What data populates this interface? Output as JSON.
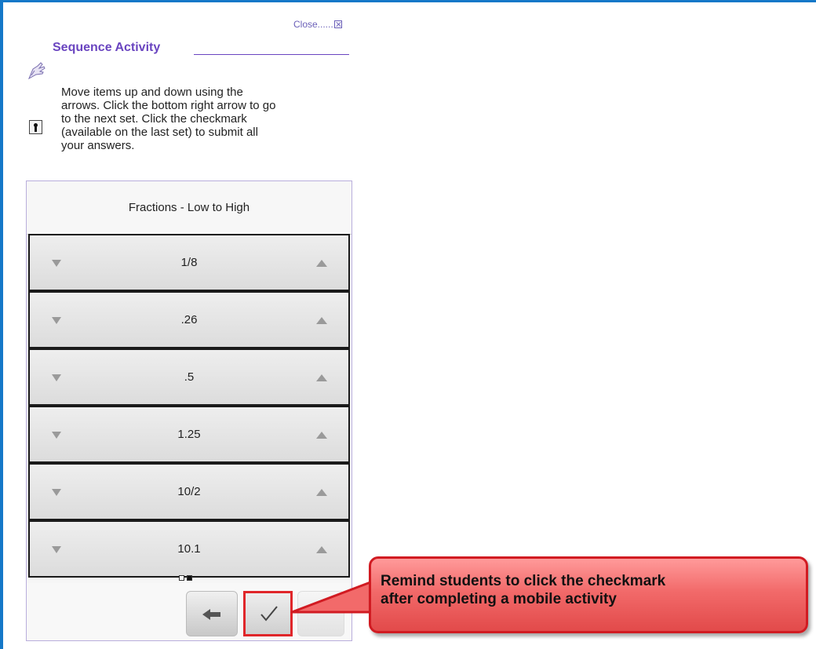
{
  "window": {
    "close_label": "Close......"
  },
  "activity": {
    "title": "Sequence Activity",
    "instructions": "Move items up and down using the\narrows. Click the bottom right arrow to go\nto the next set. Click the checkmark\n(available on the last set) to submit all\nyour answers.",
    "set_title": "Fractions - Low to High",
    "items": [
      {
        "label": "1/8"
      },
      {
        "label": ".26"
      },
      {
        "label": ".5"
      },
      {
        "label": "1.25"
      },
      {
        "label": "10/2"
      },
      {
        "label": "10.1"
      }
    ],
    "pager": {
      "total": 2,
      "current": 2
    }
  },
  "icons": {
    "activity": "activity-hand-icon",
    "key": "keyhole-icon",
    "move_down": "triangle-down-icon",
    "move_up": "triangle-up-icon",
    "back": "arrow-left-icon",
    "submit": "checkmark-icon",
    "close": "close-box-icon"
  },
  "callout": {
    "text": "Remind students to click the checkmark\nafter completing a mobile activity"
  },
  "colors": {
    "frame": "#1478c8",
    "title": "#6a45c0",
    "callout_fill": "#f26a6a",
    "callout_border": "#d11b22",
    "highlight": "#e0262a"
  }
}
